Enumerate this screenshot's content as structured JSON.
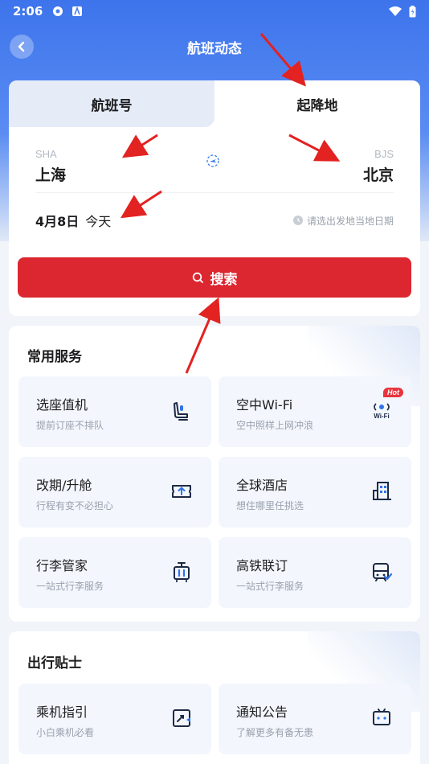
{
  "status_bar": {
    "time": "2:06"
  },
  "header": {
    "title": "航班动态"
  },
  "tabs": [
    {
      "label": "航班号",
      "active": false
    },
    {
      "label": "起降地",
      "active": true
    }
  ],
  "route": {
    "from": {
      "code": "SHA",
      "name": "上海"
    },
    "to": {
      "code": "BJS",
      "name": "北京"
    }
  },
  "date": {
    "main": "4月8日",
    "day": "今天",
    "hint": "请选出发地当地日期"
  },
  "search_button": {
    "label": "搜索"
  },
  "common_services": {
    "title": "常用服务",
    "items": [
      {
        "title": "选座值机",
        "subtitle": "提前订座不排队",
        "icon": "seat-icon"
      },
      {
        "title": "空中Wi-Fi",
        "subtitle": "空中照样上网冲浪",
        "icon": "wifi-icon",
        "badge": "Hot",
        "icon_text": "Wi-Fi"
      },
      {
        "title": "改期/升舱",
        "subtitle": "行程有变不必担心",
        "icon": "ticket-upgrade-icon"
      },
      {
        "title": "全球酒店",
        "subtitle": "想住哪里任挑选",
        "icon": "hotel-icon"
      },
      {
        "title": "行李管家",
        "subtitle": "一站式行李服务",
        "icon": "luggage-icon"
      },
      {
        "title": "高铁联订",
        "subtitle": "一站式行李服务",
        "icon": "train-icon"
      }
    ]
  },
  "travel_tips": {
    "title": "出行贴士",
    "items": [
      {
        "title": "乘机指引",
        "subtitle": "小白乘机必看",
        "icon": "guide-icon"
      },
      {
        "title": "通知公告",
        "subtitle": "了解更多有备无患",
        "icon": "notice-icon"
      }
    ]
  },
  "colors": {
    "primary_blue": "#3d74ec",
    "search_red": "#dc2630",
    "annotation_red": "#e32222"
  }
}
